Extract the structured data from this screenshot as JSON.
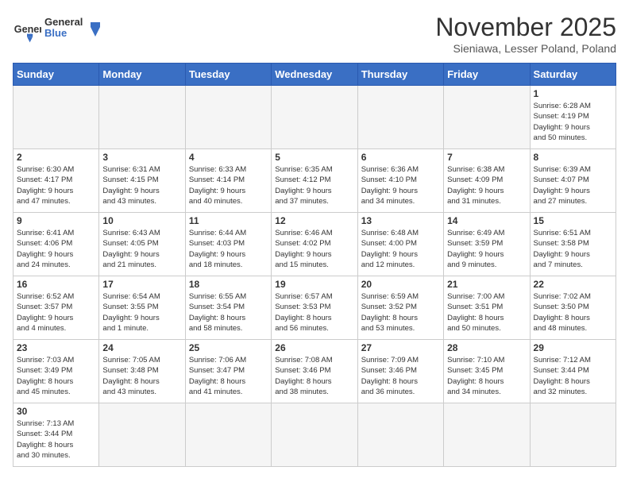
{
  "header": {
    "logo_general": "General",
    "logo_blue": "Blue",
    "title": "November 2025",
    "subtitle": "Sieniawa, Lesser Poland, Poland"
  },
  "days_of_week": [
    "Sunday",
    "Monday",
    "Tuesday",
    "Wednesday",
    "Thursday",
    "Friday",
    "Saturday"
  ],
  "weeks": [
    [
      {
        "day": "",
        "info": ""
      },
      {
        "day": "",
        "info": ""
      },
      {
        "day": "",
        "info": ""
      },
      {
        "day": "",
        "info": ""
      },
      {
        "day": "",
        "info": ""
      },
      {
        "day": "",
        "info": ""
      },
      {
        "day": "1",
        "info": "Sunrise: 6:28 AM\nSunset: 4:19 PM\nDaylight: 9 hours\nand 50 minutes."
      }
    ],
    [
      {
        "day": "2",
        "info": "Sunrise: 6:30 AM\nSunset: 4:17 PM\nDaylight: 9 hours\nand 47 minutes."
      },
      {
        "day": "3",
        "info": "Sunrise: 6:31 AM\nSunset: 4:15 PM\nDaylight: 9 hours\nand 43 minutes."
      },
      {
        "day": "4",
        "info": "Sunrise: 6:33 AM\nSunset: 4:14 PM\nDaylight: 9 hours\nand 40 minutes."
      },
      {
        "day": "5",
        "info": "Sunrise: 6:35 AM\nSunset: 4:12 PM\nDaylight: 9 hours\nand 37 minutes."
      },
      {
        "day": "6",
        "info": "Sunrise: 6:36 AM\nSunset: 4:10 PM\nDaylight: 9 hours\nand 34 minutes."
      },
      {
        "day": "7",
        "info": "Sunrise: 6:38 AM\nSunset: 4:09 PM\nDaylight: 9 hours\nand 31 minutes."
      },
      {
        "day": "8",
        "info": "Sunrise: 6:39 AM\nSunset: 4:07 PM\nDaylight: 9 hours\nand 27 minutes."
      }
    ],
    [
      {
        "day": "9",
        "info": "Sunrise: 6:41 AM\nSunset: 4:06 PM\nDaylight: 9 hours\nand 24 minutes."
      },
      {
        "day": "10",
        "info": "Sunrise: 6:43 AM\nSunset: 4:05 PM\nDaylight: 9 hours\nand 21 minutes."
      },
      {
        "day": "11",
        "info": "Sunrise: 6:44 AM\nSunset: 4:03 PM\nDaylight: 9 hours\nand 18 minutes."
      },
      {
        "day": "12",
        "info": "Sunrise: 6:46 AM\nSunset: 4:02 PM\nDaylight: 9 hours\nand 15 minutes."
      },
      {
        "day": "13",
        "info": "Sunrise: 6:48 AM\nSunset: 4:00 PM\nDaylight: 9 hours\nand 12 minutes."
      },
      {
        "day": "14",
        "info": "Sunrise: 6:49 AM\nSunset: 3:59 PM\nDaylight: 9 hours\nand 9 minutes."
      },
      {
        "day": "15",
        "info": "Sunrise: 6:51 AM\nSunset: 3:58 PM\nDaylight: 9 hours\nand 7 minutes."
      }
    ],
    [
      {
        "day": "16",
        "info": "Sunrise: 6:52 AM\nSunset: 3:57 PM\nDaylight: 9 hours\nand 4 minutes."
      },
      {
        "day": "17",
        "info": "Sunrise: 6:54 AM\nSunset: 3:55 PM\nDaylight: 9 hours\nand 1 minute."
      },
      {
        "day": "18",
        "info": "Sunrise: 6:55 AM\nSunset: 3:54 PM\nDaylight: 8 hours\nand 58 minutes."
      },
      {
        "day": "19",
        "info": "Sunrise: 6:57 AM\nSunset: 3:53 PM\nDaylight: 8 hours\nand 56 minutes."
      },
      {
        "day": "20",
        "info": "Sunrise: 6:59 AM\nSunset: 3:52 PM\nDaylight: 8 hours\nand 53 minutes."
      },
      {
        "day": "21",
        "info": "Sunrise: 7:00 AM\nSunset: 3:51 PM\nDaylight: 8 hours\nand 50 minutes."
      },
      {
        "day": "22",
        "info": "Sunrise: 7:02 AM\nSunset: 3:50 PM\nDaylight: 8 hours\nand 48 minutes."
      }
    ],
    [
      {
        "day": "23",
        "info": "Sunrise: 7:03 AM\nSunset: 3:49 PM\nDaylight: 8 hours\nand 45 minutes."
      },
      {
        "day": "24",
        "info": "Sunrise: 7:05 AM\nSunset: 3:48 PM\nDaylight: 8 hours\nand 43 minutes."
      },
      {
        "day": "25",
        "info": "Sunrise: 7:06 AM\nSunset: 3:47 PM\nDaylight: 8 hours\nand 41 minutes."
      },
      {
        "day": "26",
        "info": "Sunrise: 7:08 AM\nSunset: 3:46 PM\nDaylight: 8 hours\nand 38 minutes."
      },
      {
        "day": "27",
        "info": "Sunrise: 7:09 AM\nSunset: 3:46 PM\nDaylight: 8 hours\nand 36 minutes."
      },
      {
        "day": "28",
        "info": "Sunrise: 7:10 AM\nSunset: 3:45 PM\nDaylight: 8 hours\nand 34 minutes."
      },
      {
        "day": "29",
        "info": "Sunrise: 7:12 AM\nSunset: 3:44 PM\nDaylight: 8 hours\nand 32 minutes."
      }
    ],
    [
      {
        "day": "30",
        "info": "Sunrise: 7:13 AM\nSunset: 3:44 PM\nDaylight: 8 hours\nand 30 minutes."
      },
      {
        "day": "",
        "info": ""
      },
      {
        "day": "",
        "info": ""
      },
      {
        "day": "",
        "info": ""
      },
      {
        "day": "",
        "info": ""
      },
      {
        "day": "",
        "info": ""
      },
      {
        "day": "",
        "info": ""
      }
    ]
  ]
}
